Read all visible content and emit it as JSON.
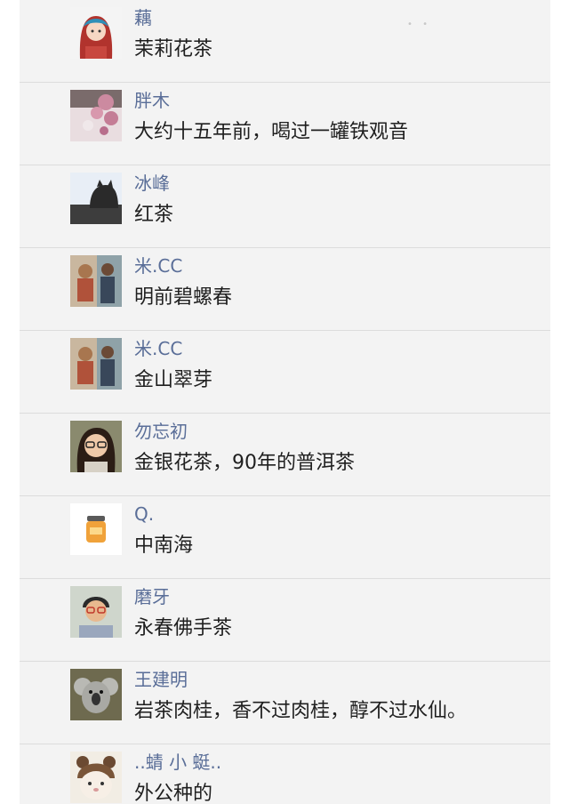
{
  "comments": [
    {
      "name": "藕",
      "text": "茉莉花茶",
      "avatar_icon": "cartoon-girl-avatar"
    },
    {
      "name": "胖木",
      "text": "大约十五年前，喝过一罐铁观音",
      "avatar_icon": "pink-blossom-avatar"
    },
    {
      "name": "冰峰",
      "text": "红茶",
      "avatar_icon": "cat-silhouette-avatar"
    },
    {
      "name": "米.CC",
      "text": "明前碧螺春",
      "avatar_icon": "children-photo-avatar"
    },
    {
      "name": "米.CC",
      "text": "金山翠芽",
      "avatar_icon": "children-photo-avatar"
    },
    {
      "name": "勿忘初",
      "text": "金银花茶，90年的普洱茶",
      "avatar_icon": "woman-glasses-avatar"
    },
    {
      "name": "Q.",
      "text": "中南海",
      "avatar_icon": "jar-icon-avatar"
    },
    {
      "name": "磨牙",
      "text": "永春佛手茶",
      "avatar_icon": "man-glasses-avatar"
    },
    {
      "name": "王建明",
      "text": "岩茶肉桂，香不过肉桂，醇不过水仙。",
      "avatar_icon": "koala-avatar"
    },
    {
      "name": "..蜻 小 蜓..",
      "text": "外公种的",
      "avatar_icon": "bear-hat-avatar"
    }
  ],
  "colors": {
    "name": "#5a6e98",
    "text": "#1f1f1f",
    "background": "#f3f3f3",
    "divider": "#dcdcdc"
  }
}
